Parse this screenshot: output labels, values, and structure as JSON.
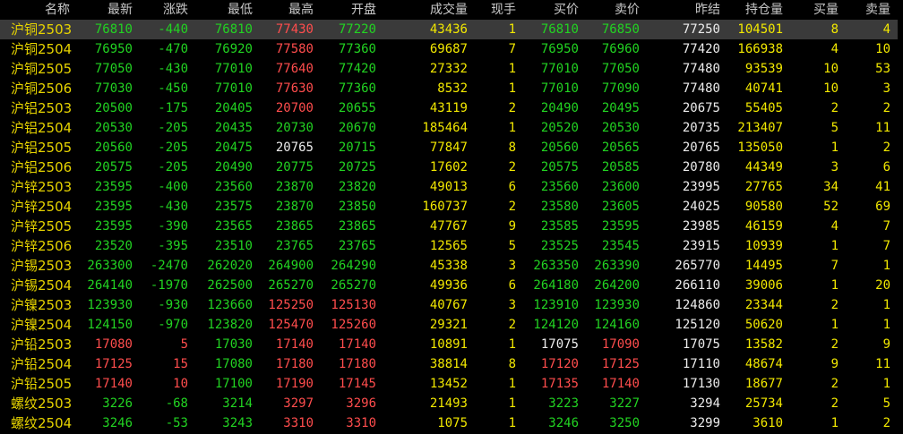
{
  "headers": {
    "name": "名称",
    "last": "最新",
    "change": "涨跌",
    "low": "最低",
    "high": "最高",
    "open": "开盘",
    "volume": "成交量",
    "current": "现手",
    "bid": "买价",
    "ask": "卖价",
    "prev": "昨结",
    "oi": "持仓量",
    "bidqty": "买量",
    "askqty": "卖量"
  },
  "colors": {
    "up": "#ff4d4d",
    "down": "#22d322",
    "flat": "#ececec",
    "name": "#e6d300",
    "volume": "#f2e800",
    "selected_row": "#3a3a3a"
  },
  "selected_index": 0,
  "rows": [
    {
      "name": "沪铜2503",
      "last": "76810",
      "change": "-440",
      "low": "76810",
      "high": "77430",
      "open": "77220",
      "volume": "43436",
      "current": "1",
      "bid": "76810",
      "ask": "76850",
      "prev": "77250",
      "oi": "104501",
      "bidqty": "8",
      "askqty": "4"
    },
    {
      "name": "沪铜2504",
      "last": "76950",
      "change": "-470",
      "low": "76920",
      "high": "77580",
      "open": "77360",
      "volume": "69687",
      "current": "7",
      "bid": "76950",
      "ask": "76960",
      "prev": "77420",
      "oi": "166938",
      "bidqty": "4",
      "askqty": "10"
    },
    {
      "name": "沪铜2505",
      "last": "77050",
      "change": "-430",
      "low": "77010",
      "high": "77640",
      "open": "77420",
      "volume": "27332",
      "current": "1",
      "bid": "77010",
      "ask": "77050",
      "prev": "77480",
      "oi": "93539",
      "bidqty": "10",
      "askqty": "53"
    },
    {
      "name": "沪铜2506",
      "last": "77030",
      "change": "-450",
      "low": "77010",
      "high": "77630",
      "open": "77360",
      "volume": "8532",
      "current": "1",
      "bid": "77010",
      "ask": "77090",
      "prev": "77480",
      "oi": "40741",
      "bidqty": "10",
      "askqty": "3"
    },
    {
      "name": "沪铝2503",
      "last": "20500",
      "change": "-175",
      "low": "20405",
      "high": "20700",
      "open": "20655",
      "volume": "43119",
      "current": "2",
      "bid": "20490",
      "ask": "20495",
      "prev": "20675",
      "oi": "55405",
      "bidqty": "2",
      "askqty": "2"
    },
    {
      "name": "沪铝2504",
      "last": "20530",
      "change": "-205",
      "low": "20435",
      "high": "20730",
      "open": "20670",
      "volume": "185464",
      "current": "1",
      "bid": "20520",
      "ask": "20530",
      "prev": "20735",
      "oi": "213407",
      "bidqty": "5",
      "askqty": "11"
    },
    {
      "name": "沪铝2505",
      "last": "20560",
      "change": "-205",
      "low": "20475",
      "high": "20765",
      "open": "20715",
      "volume": "77847",
      "current": "8",
      "bid": "20560",
      "ask": "20565",
      "prev": "20765",
      "oi": "135050",
      "bidqty": "1",
      "askqty": "2"
    },
    {
      "name": "沪铝2506",
      "last": "20575",
      "change": "-205",
      "low": "20490",
      "high": "20775",
      "open": "20725",
      "volume": "17602",
      "current": "2",
      "bid": "20575",
      "ask": "20585",
      "prev": "20780",
      "oi": "44349",
      "bidqty": "3",
      "askqty": "6"
    },
    {
      "name": "沪锌2503",
      "last": "23595",
      "change": "-400",
      "low": "23560",
      "high": "23870",
      "open": "23820",
      "volume": "49013",
      "current": "6",
      "bid": "23560",
      "ask": "23600",
      "prev": "23995",
      "oi": "27765",
      "bidqty": "34",
      "askqty": "41"
    },
    {
      "name": "沪锌2504",
      "last": "23595",
      "change": "-430",
      "low": "23575",
      "high": "23870",
      "open": "23850",
      "volume": "160737",
      "current": "2",
      "bid": "23580",
      "ask": "23605",
      "prev": "24025",
      "oi": "90580",
      "bidqty": "52",
      "askqty": "69"
    },
    {
      "name": "沪锌2505",
      "last": "23595",
      "change": "-390",
      "low": "23565",
      "high": "23865",
      "open": "23865",
      "volume": "47767",
      "current": "9",
      "bid": "23585",
      "ask": "23595",
      "prev": "23985",
      "oi": "46159",
      "bidqty": "4",
      "askqty": "7"
    },
    {
      "name": "沪锌2506",
      "last": "23520",
      "change": "-395",
      "low": "23510",
      "high": "23765",
      "open": "23765",
      "volume": "12565",
      "current": "5",
      "bid": "23525",
      "ask": "23545",
      "prev": "23915",
      "oi": "10939",
      "bidqty": "1",
      "askqty": "7"
    },
    {
      "name": "沪锡2503",
      "last": "263300",
      "change": "-2470",
      "low": "262020",
      "high": "264900",
      "open": "264290",
      "volume": "45338",
      "current": "3",
      "bid": "263350",
      "ask": "263390",
      "prev": "265770",
      "oi": "14495",
      "bidqty": "7",
      "askqty": "1"
    },
    {
      "name": "沪锡2504",
      "last": "264140",
      "change": "-1970",
      "low": "262500",
      "high": "265270",
      "open": "265270",
      "volume": "49936",
      "current": "6",
      "bid": "264180",
      "ask": "264200",
      "prev": "266110",
      "oi": "39006",
      "bidqty": "1",
      "askqty": "20"
    },
    {
      "name": "沪镍2503",
      "last": "123930",
      "change": "-930",
      "low": "123660",
      "high": "125250",
      "open": "125130",
      "volume": "40767",
      "current": "3",
      "bid": "123910",
      "ask": "123930",
      "prev": "124860",
      "oi": "23344",
      "bidqty": "2",
      "askqty": "1"
    },
    {
      "name": "沪镍2504",
      "last": "124150",
      "change": "-970",
      "low": "123820",
      "high": "125470",
      "open": "125260",
      "volume": "29321",
      "current": "2",
      "bid": "124120",
      "ask": "124160",
      "prev": "125120",
      "oi": "50620",
      "bidqty": "1",
      "askqty": "1"
    },
    {
      "name": "沪铅2503",
      "last": "17080",
      "change": "5",
      "low": "17030",
      "high": "17140",
      "open": "17140",
      "volume": "10891",
      "current": "1",
      "bid": "17075",
      "ask": "17090",
      "prev": "17075",
      "oi": "13582",
      "bidqty": "2",
      "askqty": "9"
    },
    {
      "name": "沪铅2504",
      "last": "17125",
      "change": "15",
      "low": "17080",
      "high": "17180",
      "open": "17180",
      "volume": "38814",
      "current": "8",
      "bid": "17120",
      "ask": "17125",
      "prev": "17110",
      "oi": "48674",
      "bidqty": "9",
      "askqty": "11"
    },
    {
      "name": "沪铅2505",
      "last": "17140",
      "change": "10",
      "low": "17100",
      "high": "17190",
      "open": "17145",
      "volume": "13452",
      "current": "1",
      "bid": "17135",
      "ask": "17140",
      "prev": "17130",
      "oi": "18677",
      "bidqty": "2",
      "askqty": "1"
    },
    {
      "name": "螺纹2503",
      "last": "3226",
      "change": "-68",
      "low": "3214",
      "high": "3297",
      "open": "3296",
      "volume": "21493",
      "current": "1",
      "bid": "3223",
      "ask": "3227",
      "prev": "3294",
      "oi": "25734",
      "bidqty": "2",
      "askqty": "5"
    },
    {
      "name": "螺纹2504",
      "last": "3246",
      "change": "-53",
      "low": "3243",
      "high": "3310",
      "open": "3310",
      "volume": "1075",
      "current": "1",
      "bid": "3246",
      "ask": "3250",
      "prev": "3299",
      "oi": "3610",
      "bidqty": "1",
      "askqty": "2"
    }
  ]
}
